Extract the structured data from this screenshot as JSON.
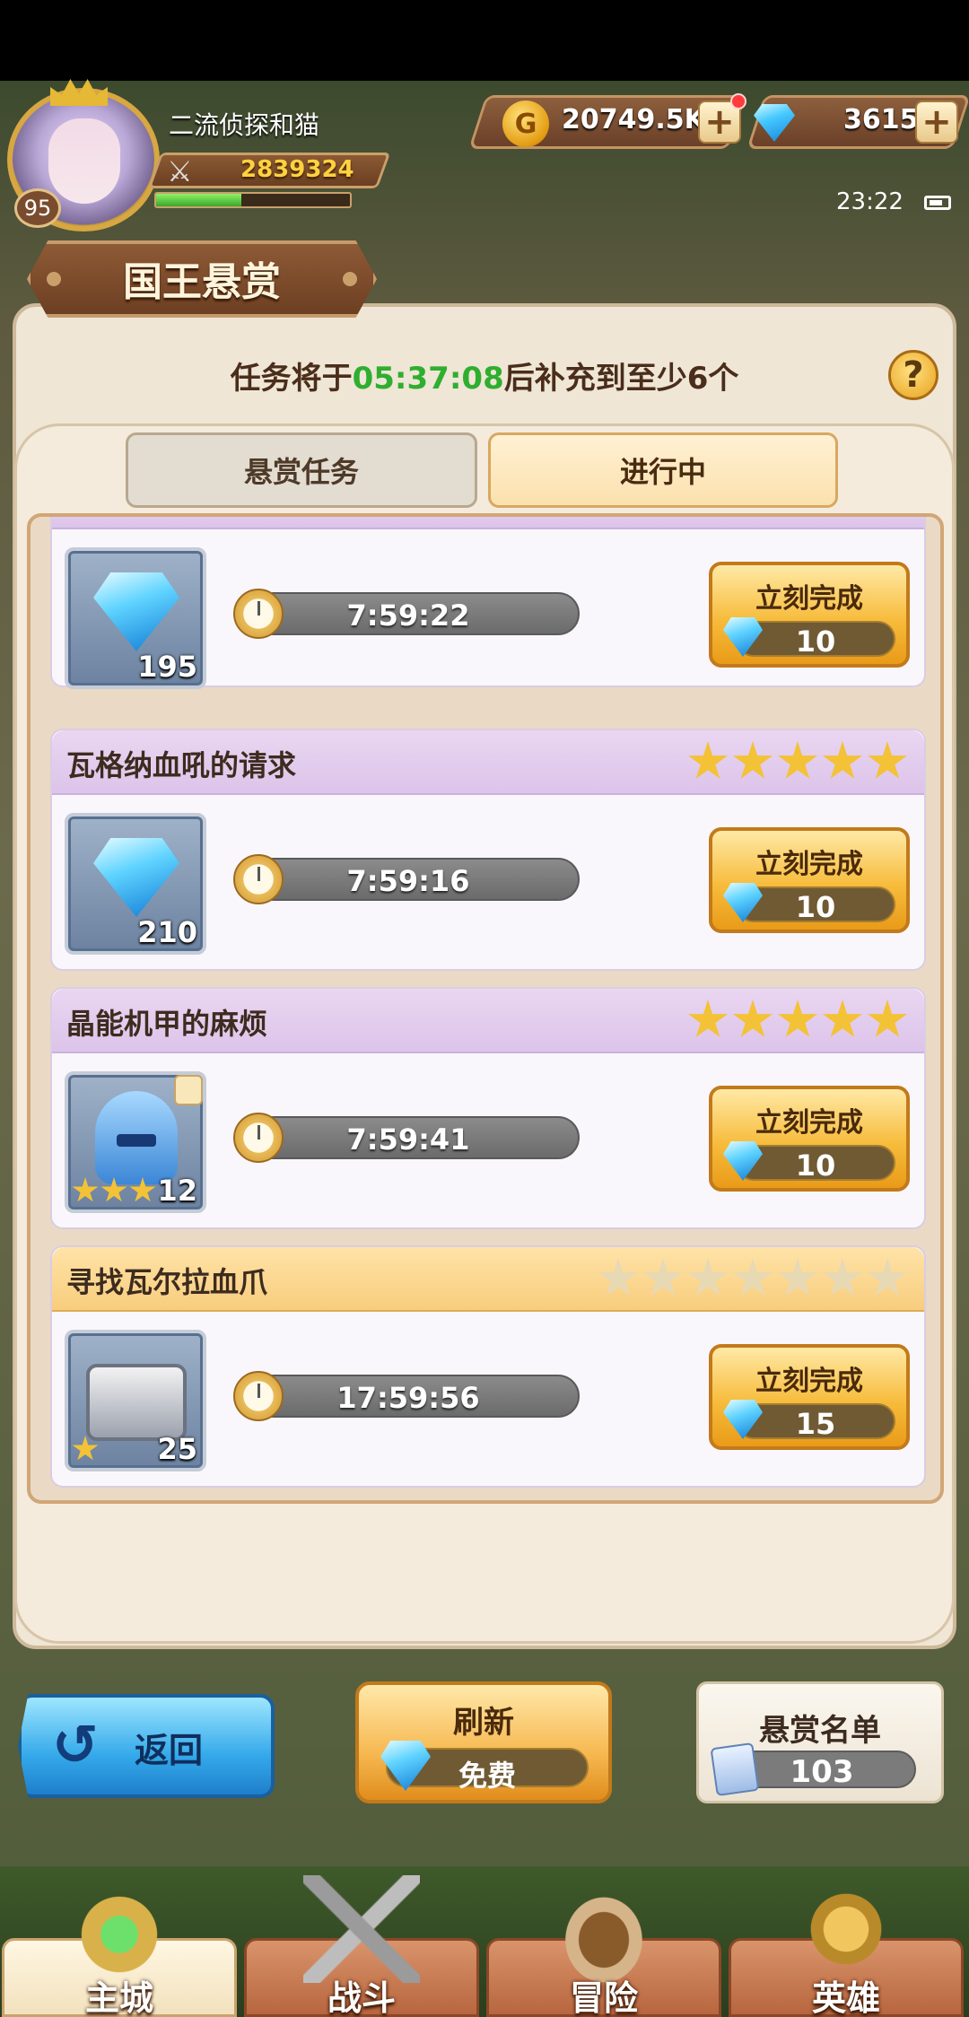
{
  "player": {
    "name": "二流侦探和猫",
    "level": "95",
    "power": "2839324",
    "exp_fraction": 0.44
  },
  "resources": {
    "gold": "20749.5K",
    "gems": "3615",
    "plus": "+"
  },
  "status": {
    "time": "23:22"
  },
  "screen": {
    "title": "国王悬赏",
    "timer_prefix": "任务将于",
    "timer_value": "05:37:08",
    "timer_suffix": "后补充到至少6个",
    "help": "?"
  },
  "tabs": [
    {
      "label": "悬赏任务",
      "active": false
    },
    {
      "label": "进行中",
      "active": true
    }
  ],
  "tasks": [
    {
      "name": "",
      "reward_icon": "gem-icon",
      "reward_count": "195",
      "countdown": "7:59:22",
      "button_label": "立刻完成",
      "cost": "10"
    },
    {
      "name": "瓦格纳血吼的请求",
      "stars": 5,
      "reward_icon": "gem-icon",
      "reward_count": "210",
      "countdown": "7:59:16",
      "button_label": "立刻完成",
      "cost": "10"
    },
    {
      "name": "晶能机甲的麻烦",
      "stars": 5,
      "reward_icon": "helmet-icon",
      "reward_stars": 3,
      "reward_count": "12",
      "countdown": "7:59:41",
      "button_label": "立刻完成",
      "cost": "10"
    },
    {
      "name": "寻找瓦尔拉血爪",
      "stars": 7,
      "reward_icon": "chest-icon",
      "reward_stars": 1,
      "reward_count": "25",
      "countdown": "17:59:56",
      "button_label": "立刻完成",
      "cost": "15"
    }
  ],
  "footer": {
    "back_label": "返回",
    "refresh_label": "刷新",
    "refresh_cost": "免费",
    "roster_label": "悬赏名单",
    "roster_count": "103"
  },
  "nav": [
    {
      "label": "主城",
      "icon": "city-emblem-icon",
      "active": true
    },
    {
      "label": "战斗",
      "icon": "crossed-swords-icon",
      "active": false
    },
    {
      "label": "冒险",
      "icon": "adventure-icon",
      "active": false
    },
    {
      "label": "英雄",
      "icon": "hero-emblem-icon",
      "active": false
    }
  ],
  "colors": {
    "timer_green": "#2fae2f",
    "accent_gold": "#f7bc3c",
    "panel_bg": "#efe6d6"
  }
}
